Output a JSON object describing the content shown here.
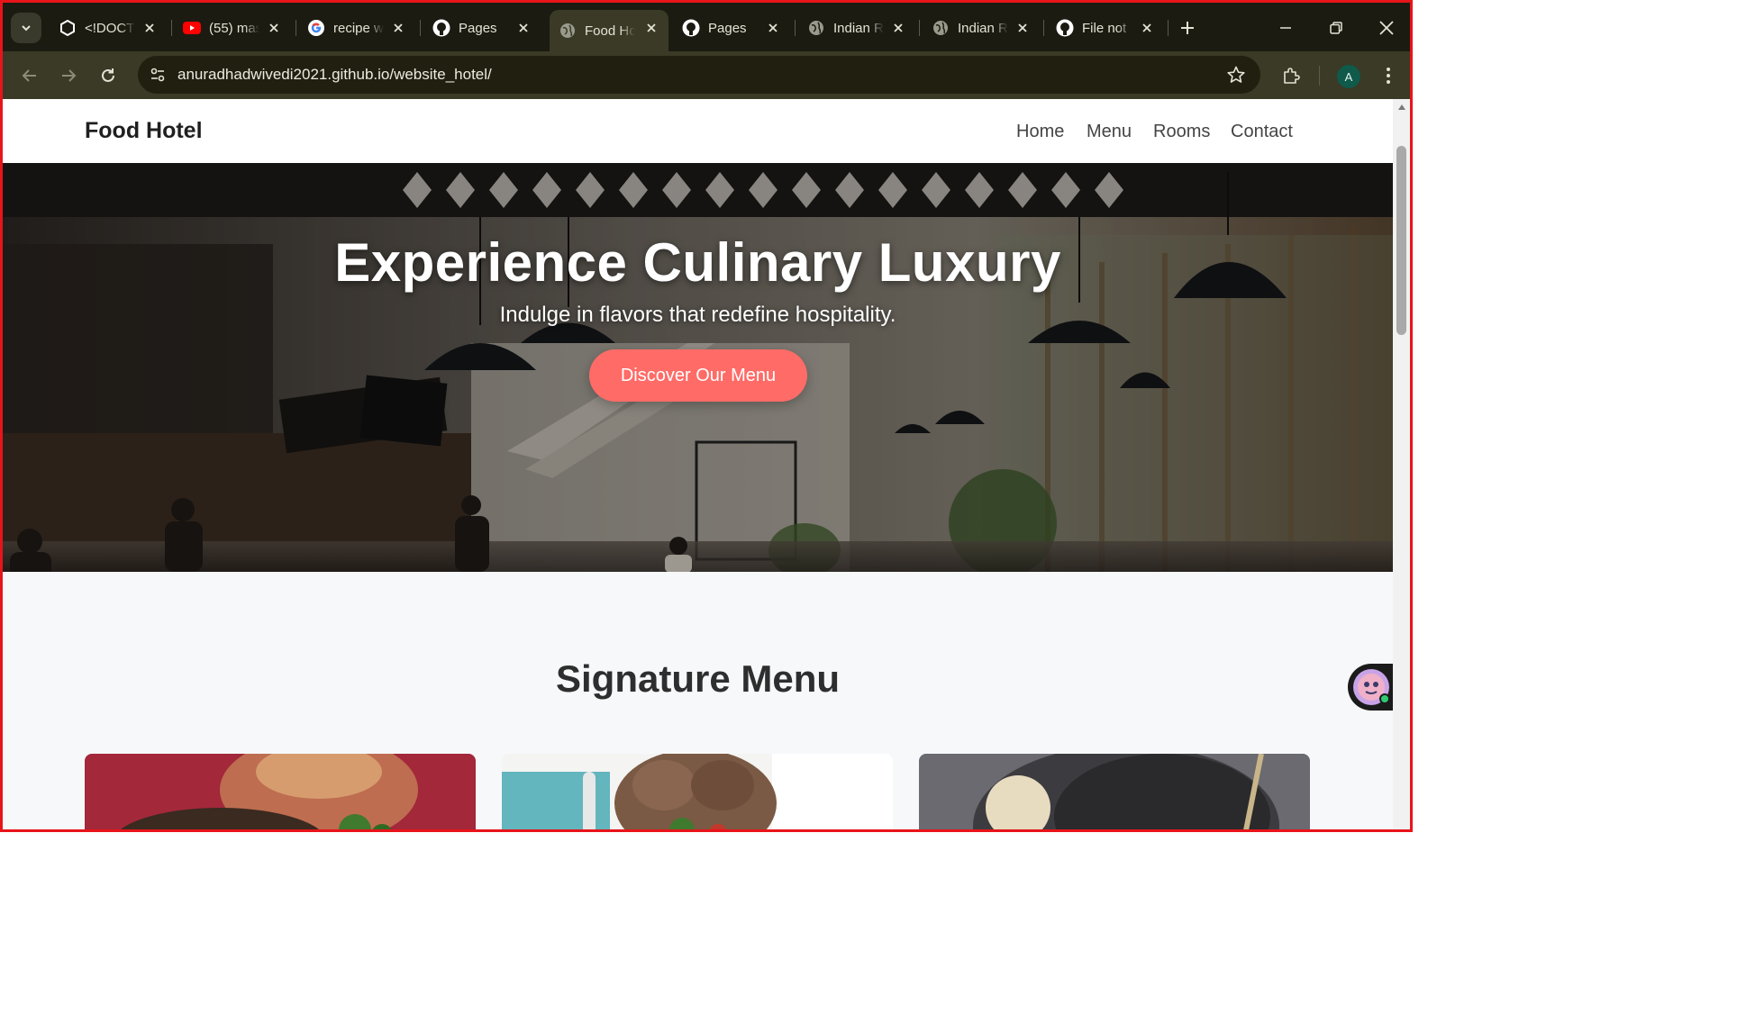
{
  "browser": {
    "tabs": [
      {
        "title": "<!DOCT",
        "favicon": "code-hexagon-icon"
      },
      {
        "title": "(55) mas",
        "favicon": "youtube-icon"
      },
      {
        "title": "recipe w",
        "favicon": "google-icon"
      },
      {
        "title": "Pages",
        "favicon": "github-icon"
      },
      {
        "title": "Food Ho",
        "favicon": "globe-icon",
        "active": true
      },
      {
        "title": "Pages",
        "favicon": "github-icon"
      },
      {
        "title": "Indian R",
        "favicon": "globe-icon"
      },
      {
        "title": "Indian R",
        "favicon": "globe-icon"
      },
      {
        "title": "File not",
        "favicon": "github-icon"
      }
    ],
    "url": "anuradhadwivedi2021.github.io/website_hotel/",
    "profile_initial": "A",
    "accent_color": "#3a3a26"
  },
  "site": {
    "brand": "Food Hotel",
    "nav": [
      "Home",
      "Menu",
      "Rooms",
      "Contact"
    ],
    "hero": {
      "title": "Experience Culinary Luxury",
      "subtitle": "Indulge in flavors that redefine hospitality.",
      "cta": "Discover Our Menu",
      "cta_color": "#ff6b67"
    },
    "section_title": "Signature Menu",
    "cards": [
      {
        "name": "dish-card-1"
      },
      {
        "name": "dish-card-2"
      },
      {
        "name": "dish-card-3"
      }
    ]
  }
}
